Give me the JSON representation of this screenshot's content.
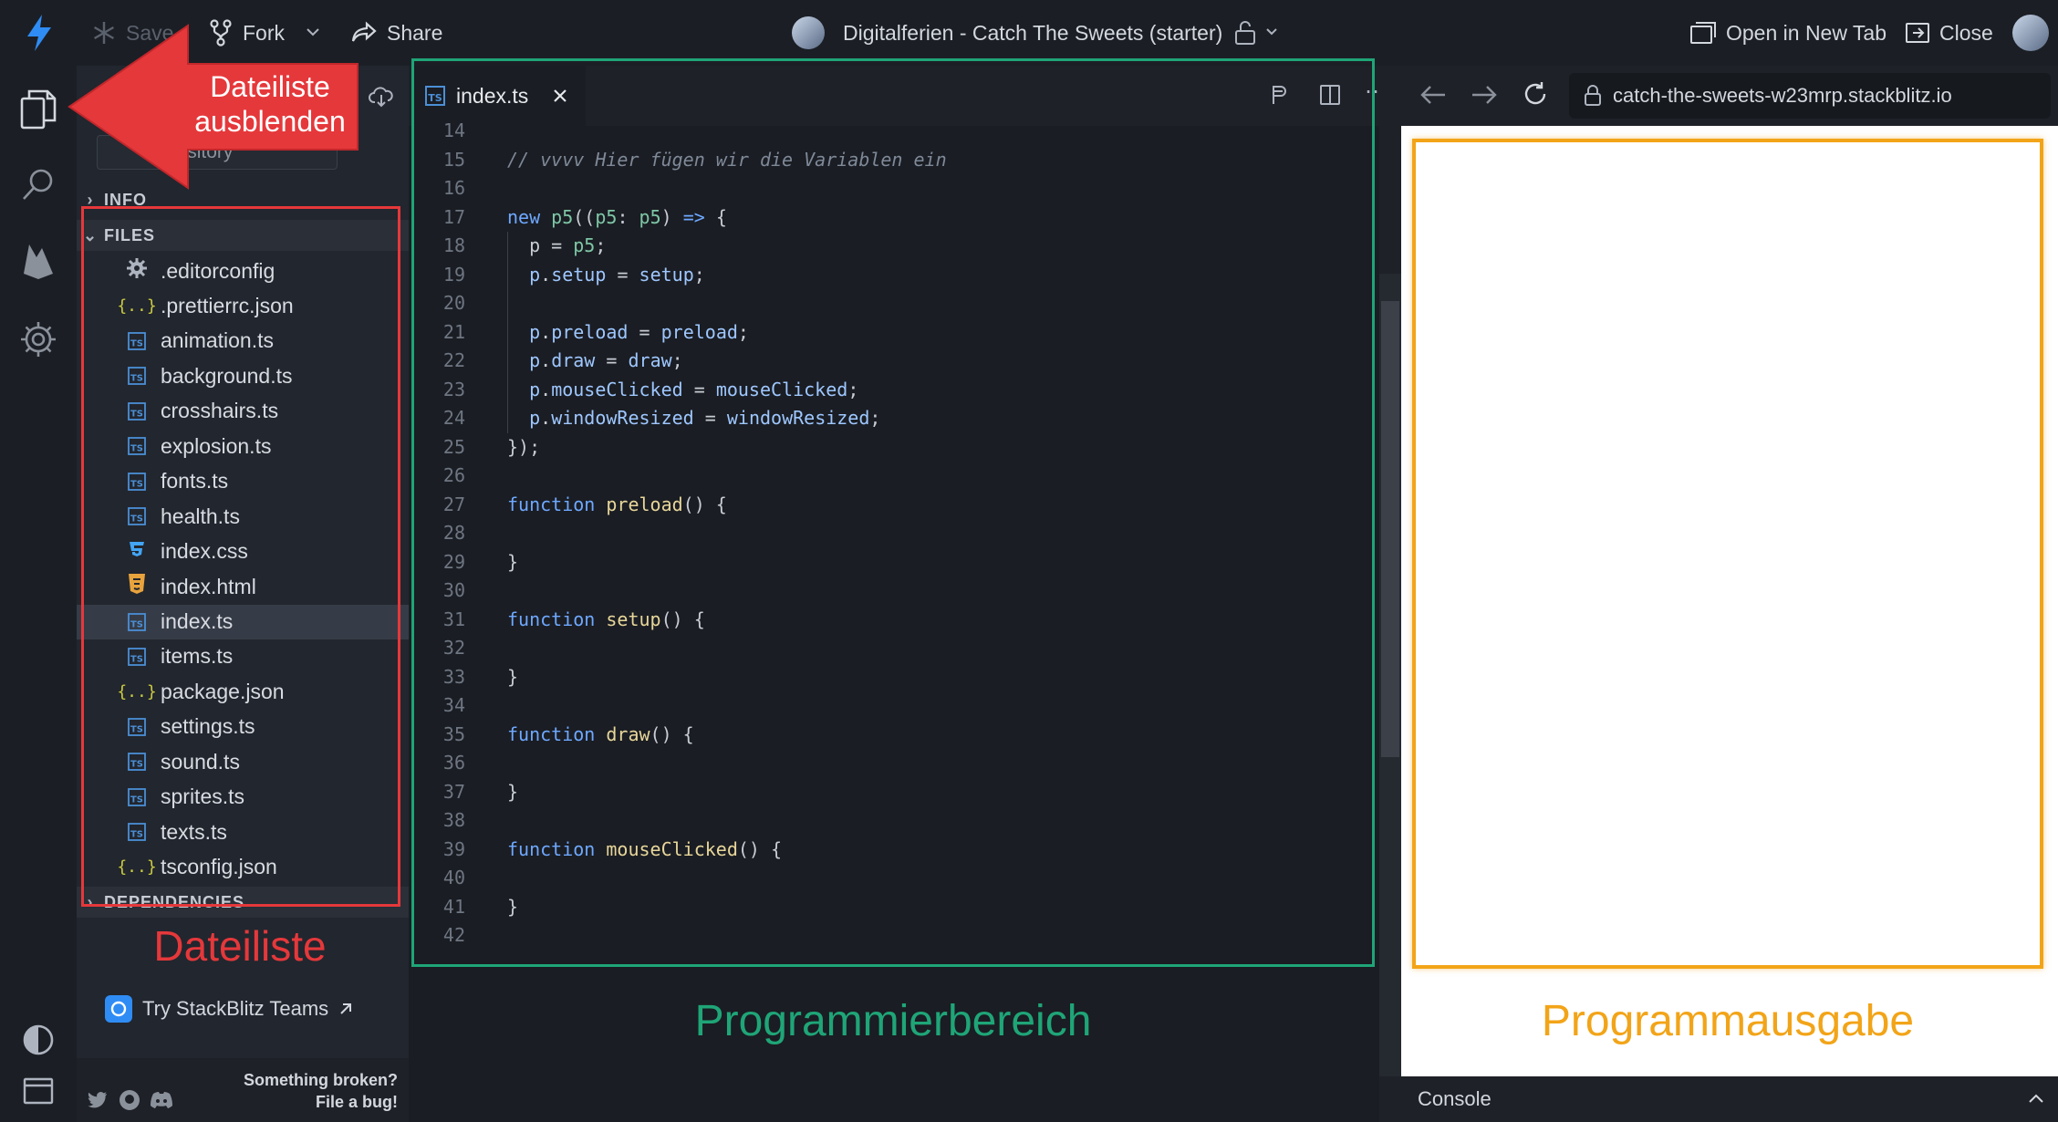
{
  "topbar": {
    "save_label": "Save",
    "fork_label": "Fork",
    "share_label": "Share",
    "project_title": "Digitalferien - Catch The Sweets (starter)",
    "open_new_tab_label": "Open in New Tab",
    "close_label": "Close"
  },
  "sidebar": {
    "repo_label": "Repository",
    "sections": {
      "info": "INFO",
      "files": "FILES",
      "dependencies": "DEPENDENCIES"
    },
    "files": [
      {
        "name": ".editorconfig",
        "icon": "gear-icon"
      },
      {
        "name": ".prettierrc.json",
        "icon": "json-icon"
      },
      {
        "name": "animation.ts",
        "icon": "typescript-icon"
      },
      {
        "name": "background.ts",
        "icon": "typescript-icon"
      },
      {
        "name": "crosshairs.ts",
        "icon": "typescript-icon"
      },
      {
        "name": "explosion.ts",
        "icon": "typescript-icon"
      },
      {
        "name": "fonts.ts",
        "icon": "typescript-icon"
      },
      {
        "name": "health.ts",
        "icon": "typescript-icon"
      },
      {
        "name": "index.css",
        "icon": "css-icon"
      },
      {
        "name": "index.html",
        "icon": "html-icon"
      },
      {
        "name": "index.ts",
        "icon": "typescript-icon",
        "active": true
      },
      {
        "name": "items.ts",
        "icon": "typescript-icon"
      },
      {
        "name": "package.json",
        "icon": "json-icon"
      },
      {
        "name": "settings.ts",
        "icon": "typescript-icon"
      },
      {
        "name": "sound.ts",
        "icon": "typescript-icon"
      },
      {
        "name": "sprites.ts",
        "icon": "typescript-icon"
      },
      {
        "name": "texts.ts",
        "icon": "typescript-icon"
      },
      {
        "name": "tsconfig.json",
        "icon": "json-icon"
      }
    ],
    "teams_label": "Try StackBlitz Teams",
    "footer_line1": "Something broken?",
    "footer_line2": "File a bug!"
  },
  "editor": {
    "tab_label": "index.ts",
    "tab_badge": "TS",
    "lines": [
      {
        "n": "14",
        "code": ""
      },
      {
        "n": "15",
        "code": "// vvvv Hier fügen wir die Variablen ein"
      },
      {
        "n": "16",
        "code": ""
      },
      {
        "n": "17",
        "code": "new p5((p5: p5) => {"
      },
      {
        "n": "18",
        "code": "  p = p5;"
      },
      {
        "n": "19",
        "code": "  p.setup = setup;"
      },
      {
        "n": "20",
        "code": ""
      },
      {
        "n": "21",
        "code": "  p.preload = preload;"
      },
      {
        "n": "22",
        "code": "  p.draw = draw;"
      },
      {
        "n": "23",
        "code": "  p.mouseClicked = mouseClicked;"
      },
      {
        "n": "24",
        "code": "  p.windowResized = windowResized;"
      },
      {
        "n": "25",
        "code": "});"
      },
      {
        "n": "26",
        "code": ""
      },
      {
        "n": "27",
        "code": "function preload() {"
      },
      {
        "n": "28",
        "code": ""
      },
      {
        "n": "29",
        "code": "}"
      },
      {
        "n": "30",
        "code": ""
      },
      {
        "n": "31",
        "code": "function setup() {"
      },
      {
        "n": "32",
        "code": ""
      },
      {
        "n": "33",
        "code": "}"
      },
      {
        "n": "34",
        "code": ""
      },
      {
        "n": "35",
        "code": "function draw() {"
      },
      {
        "n": "36",
        "code": ""
      },
      {
        "n": "37",
        "code": "}"
      },
      {
        "n": "38",
        "code": ""
      },
      {
        "n": "39",
        "code": "function mouseClicked() {"
      },
      {
        "n": "40",
        "code": ""
      },
      {
        "n": "41",
        "code": "}"
      },
      {
        "n": "42",
        "code": ""
      }
    ]
  },
  "preview": {
    "url": "catch-the-sweets-w23mrp.stackblitz.io",
    "console_label": "Console"
  },
  "annotations": {
    "hide_filelist": "Dateiliste ausblenden",
    "filelist": "Dateiliste",
    "programming_area": "Programmierbereich",
    "program_output": "Programmausgabe",
    "colors": {
      "red": "#e5383b",
      "green": "#1fa577",
      "orange": "#f2a418"
    }
  }
}
